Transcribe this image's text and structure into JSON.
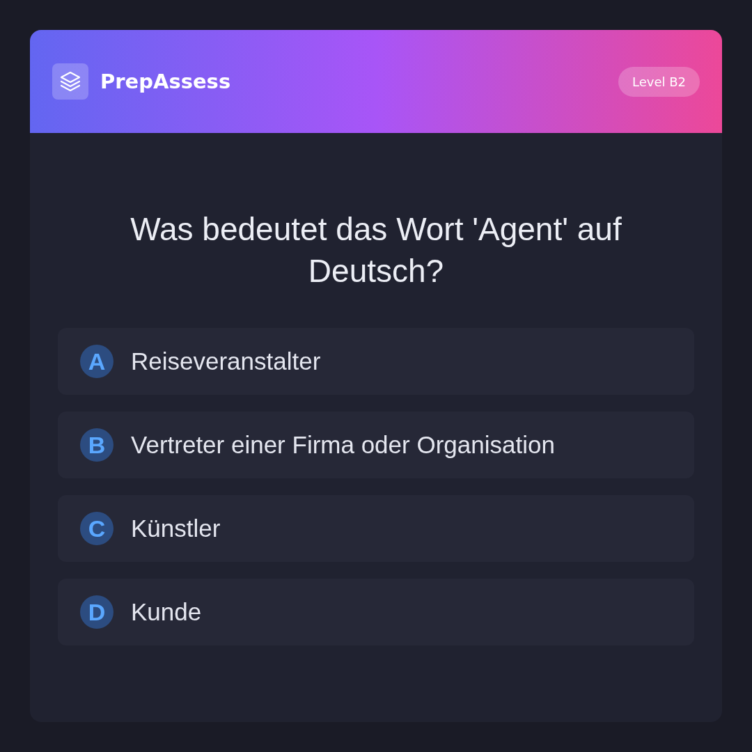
{
  "header": {
    "brand": "PrepAssess",
    "badge": "Level B2"
  },
  "question": "Was bedeutet das Wort 'Agent' auf Deutsch?",
  "options": [
    {
      "letter": "A",
      "text": "Reiseveranstalter"
    },
    {
      "letter": "B",
      "text": "Vertreter einer Firma oder Organisation"
    },
    {
      "letter": "C",
      "text": "Künstler"
    },
    {
      "letter": "D",
      "text": "Kunde"
    }
  ]
}
